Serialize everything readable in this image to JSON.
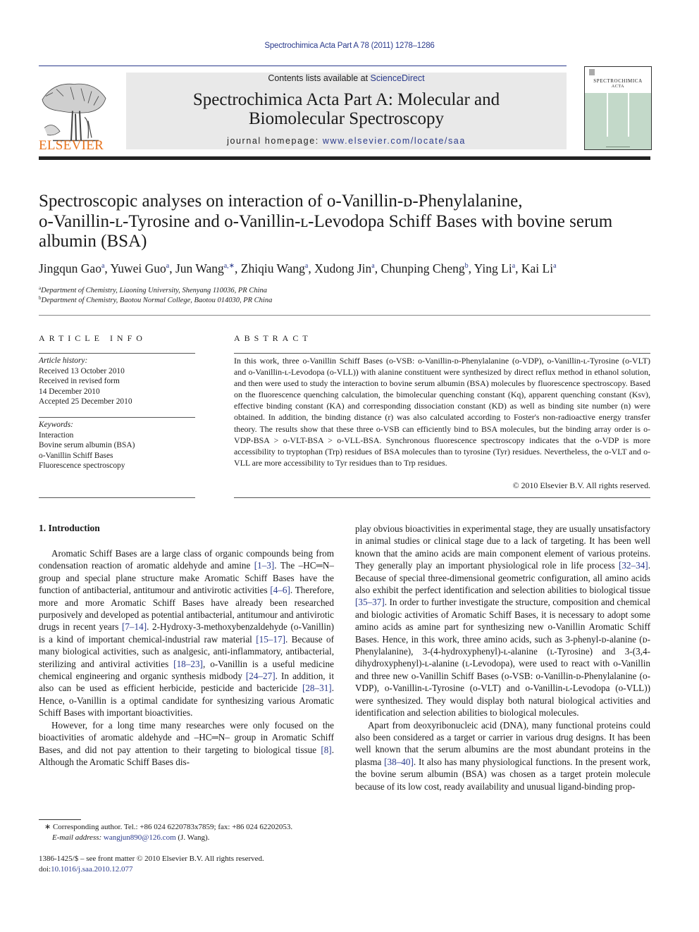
{
  "header": {
    "citation": "Spectrochimica Acta Part A 78 (2011) 1278–1286",
    "contents_prefix": "Contents lists available at ",
    "contents_link": "ScienceDirect",
    "journal_title_line1": "Spectrochimica Acta Part A: Molecular and",
    "journal_title_line2": "Biomolecular Spectroscopy",
    "homepage_prefix": "journal homepage: ",
    "homepage_link": "www.elsevier.com/locate/saa",
    "publisher_wordmark": "ELSEVIER",
    "cover_title_line1": "SPECTROCHIMICA",
    "cover_title_line2": "ACTA"
  },
  "article": {
    "title_line1": "Spectroscopic analyses on interaction of o-Vanillin-ᴅ-Phenylalanine,",
    "title_line2": "o-Vanillin-ʟ-Tyrosine and o-Vanillin-ʟ-Levodopa Schiff Bases with bovine serum",
    "title_line3": "albumin (BSA)",
    "authors": [
      {
        "name": "Jingqun Gao",
        "sup": "a"
      },
      {
        "name": "Yuwei Guo",
        "sup": "a"
      },
      {
        "name": "Jun Wang",
        "sup": "a,∗"
      },
      {
        "name": "Zhiqiu Wang",
        "sup": "a"
      },
      {
        "name": "Xudong Jin",
        "sup": "a"
      },
      {
        "name": "Chunping Cheng",
        "sup": "b"
      },
      {
        "name": "Ying Li",
        "sup": "a"
      },
      {
        "name": "Kai Li",
        "sup": "a"
      }
    ],
    "affiliations": [
      {
        "mark": "a",
        "text": "Department of Chemistry, Liaoning University, Shenyang 110036, PR China"
      },
      {
        "mark": "b",
        "text": "Department of Chemistry, Baotou Normal College, Baotou 014030, PR China"
      }
    ]
  },
  "article_info": {
    "heading": "ARTICLE INFO",
    "history_label": "Article history:",
    "history": [
      "Received 13 October 2010",
      "Received in revised form",
      "14 December 2010",
      "Accepted 25 December 2010"
    ],
    "keywords_label": "Keywords:",
    "keywords": [
      "Interaction",
      "Bovine serum albumin (BSA)",
      "o-Vanillin Schiff Bases",
      "Fluorescence spectroscopy"
    ]
  },
  "abstract": {
    "heading": "ABSTRACT",
    "text": "In this work, three o-Vanillin Schiff Bases (o-VSB: o-Vanillin-ᴅ-Phenylalanine (o-VDP), o-Vanillin-ʟ-Tyrosine (o-VLT) and o-Vanillin-ʟ-Levodopa (o-VLL)) with alanine constituent were synthesized by direct reflux method in ethanol solution, and then were used to study the interaction to bovine serum albumin (BSA) molecules by fluorescence spectroscopy. Based on the fluorescence quenching calculation, the bimolecular quenching constant (Kq), apparent quenching constant (Ksv), effective binding constant (KA) and corresponding dissociation constant (KD) as well as binding site number (n) were obtained. In addition, the binding distance (r) was also calculated according to Foster's non-radioactive energy transfer theory. The results show that these three o-VSB can efficiently bind to BSA molecules, but the binding array order is o-VDP-BSA > o-VLT-BSA > o-VLL-BSA. Synchronous fluorescence spectroscopy indicates that the o-VDP is more accessibility to tryptophan (Trp) residues of BSA molecules than to tyrosine (Tyr) residues. Nevertheless, the o-VLT and o-VLL are more accessibility to Tyr residues than to Trp residues.",
    "copyright": "© 2010 Elsevier B.V. All rights reserved."
  },
  "introduction": {
    "heading": "1.  Introduction",
    "left_paragraphs": [
      [
        {
          "t": "Aromatic Schiff Bases are a large class of organic compounds being from condensation reaction of aromatic aldehyde and amine "
        },
        {
          "ref": "[1–3]"
        },
        {
          "t": ". The –HC═N– group and special plane structure make Aromatic Schiff Bases have the function of antibacterial, antitumour and antivirotic activities "
        },
        {
          "ref": "[4–6]"
        },
        {
          "t": ". Therefore, more and more Aromatic Schiff Bases have already been researched purposively and developed as potential antibacterial, antitumour and antivirotic drugs in recent years "
        },
        {
          "ref": "[7–14]"
        },
        {
          "t": ". 2-Hydroxy-3-methoxybenzaldehyde (o-Vanillin) is a kind of important chemical-industrial raw material "
        },
        {
          "ref": "[15–17]"
        },
        {
          "t": ". Because of many biological activities, such as analgesic, anti-inflammatory, antibacterial, sterilizing and antiviral activities "
        },
        {
          "ref": "[18–23]"
        },
        {
          "t": ", o-Vanillin is a useful medicine chemical engineering and organic synthesis midbody "
        },
        {
          "ref": "[24–27]"
        },
        {
          "t": ". In addition, it also can be used as efficient herbicide, pesticide and bactericide "
        },
        {
          "ref": "[28–31]"
        },
        {
          "t": ". Hence, o-Vanillin is a optimal candidate for synthesizing various Aromatic Schiff Bases with important bioactivities."
        }
      ],
      [
        {
          "t": "However, for a long time many researches were only focused on the bioactivities of aromatic aldehyde and –HC═N– group in Aromatic Schiff Bases, and did not pay attention to their targeting to biological tissue "
        },
        {
          "ref": "[8]"
        },
        {
          "t": ". Although the Aromatic Schiff Bases dis-"
        }
      ]
    ],
    "right_paragraphs": [
      [
        {
          "t": "play obvious bioactivities in experimental stage, they are usually unsatisfactory in animal studies or clinical stage due to a lack of targeting. It has been well known that the amino acids are main component element of various proteins. They generally play an important physiological role in life process "
        },
        {
          "ref": "[32–34]"
        },
        {
          "t": ". Because of special three-dimensional geometric configuration, all amino acids also exhibit the perfect identification and selection abilities to biological tissue "
        },
        {
          "ref": "[35–37]"
        },
        {
          "t": ". In order to further investigate the structure, composition and chemical and biologic activities of Aromatic Schiff Bases, it is necessary to adopt some amino acids as amine part for synthesizing new o-Vanillin Aromatic Schiff Bases. Hence, in this work, three amino acids, such as 3-phenyl-ᴅ-alanine (ᴅ-Phenylalanine), 3-(4-hydroxyphenyl)-ʟ-alanine (ʟ-Tyrosine) and 3-(3,4-dihydroxyphenyl)-ʟ-alanine (ʟ-Levodopa), were used to react with o-Vanillin and three new o-Vanillin Schiff Bases (o-VSB: o-Vanillin-ᴅ-Phenylalanine (o-VDP), o-Vanillin-ʟ-Tyrosine (o-VLT) and o-Vanillin-ʟ-Levodopa (o-VLL)) were synthesized. They would display both natural biological activities and identification and selection abilities to biological molecules."
        }
      ],
      [
        {
          "t": "Apart from deoxyribonucleic acid (DNA), many functional proteins could also been considered as a target or carrier in various drug designs. It has been well known that the serum albumins are the most abundant proteins in the plasma "
        },
        {
          "ref": "[38–40]"
        },
        {
          "t": ". It also has many physiological functions. In the present work, the bovine serum albumin (BSA) was chosen as a target protein molecule because of its low cost, ready availability and unusual ligand-binding prop-"
        }
      ]
    ]
  },
  "footnote": {
    "corresponding": "∗ Corresponding author. Tel.: +86 024 6220783x7859; fax: +86 024 62202053.",
    "email_label": "E-mail address: ",
    "email": "wangjun890@126.com",
    "email_suffix": " (J. Wang)."
  },
  "front_matter": {
    "issn_line": "1386-1425/$ – see front matter © 2010 Elsevier B.V. All rights reserved.",
    "doi_prefix": "doi:",
    "doi": "10.1016/j.saa.2010.12.077"
  },
  "colors": {
    "link": "#2a3a8c",
    "elsevier_orange": "#e8731c",
    "header_box": "#e9e9e9",
    "cover_green": "#c3d9c9"
  }
}
